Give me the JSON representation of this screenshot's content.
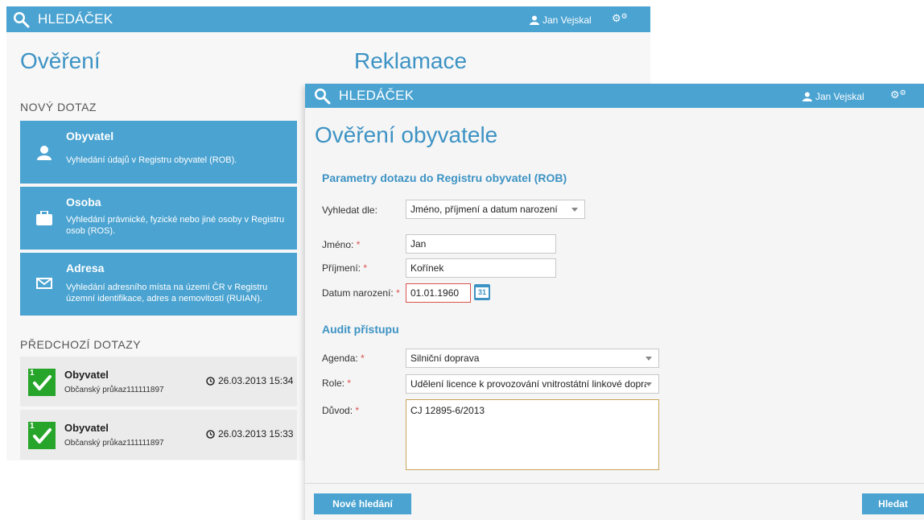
{
  "app": {
    "brand": "HLEDÁČEK",
    "user": "Jan Vejskal"
  },
  "back": {
    "title": "Ověření",
    "center_title": "Reklamace",
    "new_query_heading": "NOVÝ DOTAZ",
    "cards": [
      {
        "title": "Obyvatel",
        "desc": "Vyhledání údajů v Registru obyvatel (ROB)."
      },
      {
        "title": "Osoba",
        "desc": "Vyhledání právnické, fyzické nebo jiné osoby v Registru osob (ROS)."
      },
      {
        "title": "Adresa",
        "desc": "Vyhledání adresního místa na území ČR v Registru územní identifikace, adres a nemovitostí (RUIAN)."
      }
    ],
    "previous_heading": "PŘEDCHOZÍ DOTAZY",
    "history": [
      {
        "badge": "1",
        "title": "Obyvatel",
        "subtitle": "Občanský průkaz111111897",
        "datetime": "26.03.2013 15:34"
      },
      {
        "badge": "1",
        "title": "Obyvatel",
        "subtitle": "Občanský průkaz111111897",
        "datetime": "26.03.2013 15:33"
      }
    ]
  },
  "front": {
    "title": "Ověření obyvatele",
    "params_heading": "Parametry dotazu do Registru obyvatel (ROB)",
    "search_by_label": "Vyhledat dle:",
    "search_by_value": "Jméno, příjmení a datum narození",
    "first_name_label": "Jméno:",
    "first_name_value": "Jan",
    "last_name_label": "Příjmení:",
    "last_name_value": "Kořínek",
    "birth_label": "Datum narození:",
    "birth_value": "01.01.1960",
    "calendar_day": "31",
    "required_mark": "*",
    "audit_heading": "Audit přístupu",
    "agenda_label": "Agenda:",
    "agenda_value": "Silniční doprava",
    "role_label": "Role:",
    "role_value": "Udělení licence k provozování vnitrostátní linkové dopravy",
    "reason_label": "Důvod:",
    "reason_value": "CJ 12895-6/2013",
    "new_search_button": "Nové hledání",
    "search_button": "Hledat"
  },
  "colors": {
    "accent": "#4aa3d1",
    "success": "#27a52a",
    "required": "#d9534f"
  }
}
